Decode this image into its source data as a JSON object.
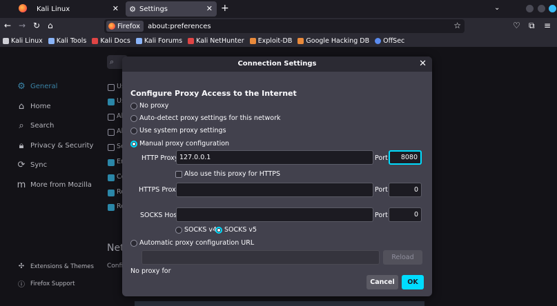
{
  "tabs": [
    {
      "label": "Kali Linux"
    },
    {
      "label": "Settings"
    }
  ],
  "navbar": {
    "identity_label": "Firefox",
    "url": "about:preferences"
  },
  "bookmarks": [
    {
      "label": "Kali Linux",
      "color": "#cfcfd6"
    },
    {
      "label": "Kali Tools",
      "color": "#8ab4f8"
    },
    {
      "label": "Kali Docs",
      "color": "#e04545"
    },
    {
      "label": "Kali Forums",
      "color": "#8ab4f8"
    },
    {
      "label": "Kali NetHunter",
      "color": "#e04545"
    },
    {
      "label": "Exploit-DB",
      "color": "#e98a3b"
    },
    {
      "label": "Google Hacking DB",
      "color": "#e98a3b"
    },
    {
      "label": "OffSec",
      "color": "#5b8cf0"
    }
  ],
  "sidebar": {
    "items": [
      {
        "label": "General"
      },
      {
        "label": "Home"
      },
      {
        "label": "Search"
      },
      {
        "label": "Privacy & Security"
      },
      {
        "label": "Sync"
      },
      {
        "label": "More from Mozilla"
      }
    ],
    "extensions": "Extensions & Themes",
    "support": "Firefox Support"
  },
  "background": {
    "check_labels": [
      "Us",
      "Us",
      "Al",
      "Al",
      "Se",
      "Er",
      "Co",
      "Re",
      "Re"
    ],
    "network_heading": "Net",
    "config_text": "Confi"
  },
  "dialog": {
    "title": "Connection Settings",
    "heading": "Configure Proxy Access to the Internet",
    "options": {
      "no_proxy": "No proxy",
      "auto_detect": "Auto-detect proxy settings for this network",
      "system": "Use system proxy settings",
      "manual": "Manual proxy configuration",
      "auto_url": "Automatic proxy configuration URL"
    },
    "http_proxy": {
      "label": "HTTP Proxy",
      "host": "127.0.0.1",
      "port_label": "Port",
      "port": "8080"
    },
    "also_https": "Also use this proxy for HTTPS",
    "https_proxy": {
      "label": "HTTPS Proxy",
      "host": "",
      "port_label": "Port",
      "port": "0"
    },
    "socks": {
      "label": "SOCKS Host",
      "host": "",
      "port_label": "Port",
      "port": "0",
      "v4": "SOCKS v4",
      "v5": "SOCKS v5"
    },
    "auto_url_value": "",
    "reload": "Reload",
    "no_proxy_for": "No proxy for",
    "cancel": "Cancel",
    "ok": "OK"
  }
}
